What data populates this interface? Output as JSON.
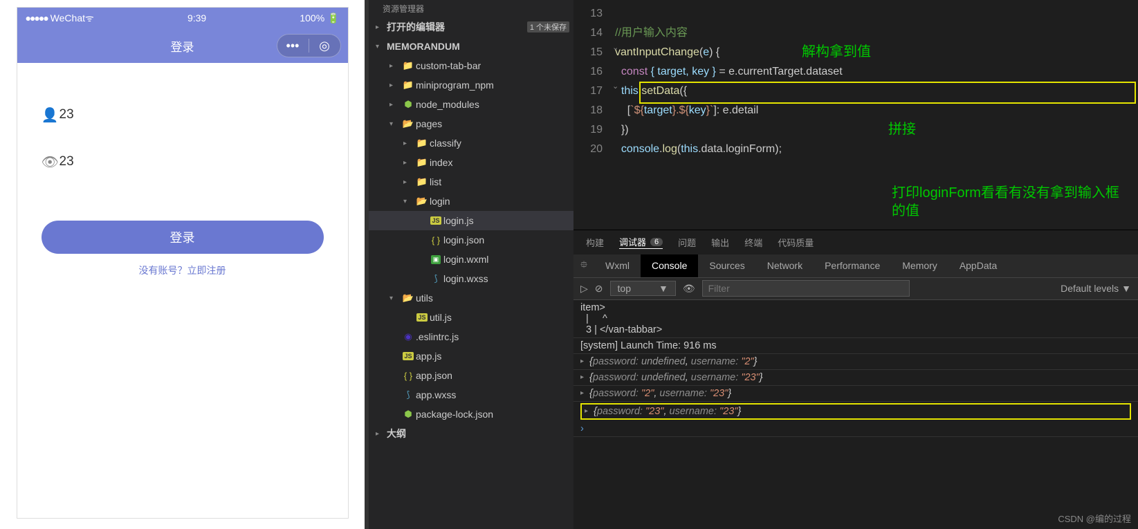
{
  "simulator": {
    "carrier": "WeChat",
    "signal_icon": "📶",
    "wifi_icon": "≋",
    "dots": "●●●●●",
    "time": "9:39",
    "battery_pct": "100%",
    "battery_icon": "▭",
    "title": "登录",
    "username_value": "23",
    "password_value": "23",
    "login_btn": "登录",
    "register_text": "没有账号？立即注册"
  },
  "explorer": {
    "header": "资源管理器",
    "open_editors": "打开的编辑器",
    "unsaved": "1 个未保存",
    "project": "MEMORANDUM",
    "items": {
      "custom": "custom-tab-bar",
      "mininpm": "miniprogram_npm",
      "nodemod": "node_modules",
      "pages": "pages",
      "classify": "classify",
      "index": "index",
      "list": "list",
      "login": "login",
      "loginjs": "login.js",
      "loginjson": "login.json",
      "loginwxml": "login.wxml",
      "loginwxss": "login.wxss",
      "utils": "utils",
      "utiljs": "util.js",
      "eslintrc": ".eslintrc.js",
      "appjs": "app.js",
      "appjson": "app.json",
      "appwxss": "app.wxss",
      "pkglock": "package-lock.json",
      "outline": "大纲"
    }
  },
  "editor": {
    "lines": [
      "13",
      "14",
      "15",
      "16",
      "17",
      "18",
      "19",
      "20"
    ],
    "comment": "//用户输入内容",
    "fn_name": "vantInputChange",
    "fn_arg": "e",
    "l16_a": "const",
    "l16_b": "{ target, key }",
    "l16_c": " = e.currentTarget.dataset",
    "l17": "this.setData({",
    "l18_a": "[`${",
    "l18_b": "target",
    "l18_c": "}.${ ",
    "l18_d": "key",
    "l18_e": "}`]: e.detail",
    "l19": "})",
    "l20": "console.log(this.data.loginForm);",
    "annot1": "解构拿到值",
    "annot2": "拼接",
    "annot3": "打印loginForm看看有没有拿到输入框的值"
  },
  "panel_tabs": {
    "build": "构建",
    "debugger": "调试器",
    "badge": "6",
    "problems": "问题",
    "output": "输出",
    "terminal": "终端",
    "quality": "代码质量"
  },
  "devtools": {
    "tabs": {
      "wxml": "Wxml",
      "console": "Console",
      "sources": "Sources",
      "network": "Network",
      "performance": "Performance",
      "memory": "Memory",
      "appdata": "AppData"
    },
    "toolbar": {
      "context": "top",
      "filter_ph": "Filter",
      "levels": "Default levels"
    },
    "pre": "item>\n  |     ^\n  3 | </van-tabbar>",
    "launch": "[system] Launch Time: 916 ms",
    "logs": [
      {
        "password_k": "password:",
        "password_v": "undefined",
        "username_k": "username:",
        "username_v": "\"2\""
      },
      {
        "password_k": "password:",
        "password_v": "undefined",
        "username_k": "username:",
        "username_v": "\"23\""
      },
      {
        "password_k": "password:",
        "password_v": "\"2\"",
        "username_k": "username:",
        "username_v": "\"23\""
      },
      {
        "password_k": "password:",
        "password_v": "\"23\"",
        "username_k": "username:",
        "username_v": "\"23\""
      }
    ]
  },
  "watermark": "CSDN @编的过程"
}
